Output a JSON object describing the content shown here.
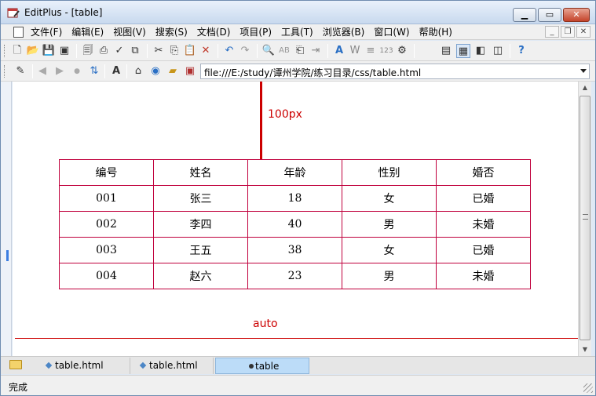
{
  "window": {
    "title": "EditPlus - [table]"
  },
  "menu": {
    "items": [
      "文件(F)",
      "编辑(E)",
      "视图(V)",
      "搜索(S)",
      "文档(D)",
      "项目(P)",
      "工具(T)",
      "浏览器(B)",
      "窗口(W)",
      "帮助(H)"
    ]
  },
  "address": {
    "url": "file:///E:/study/谭州学院/练习目录/css/table.html"
  },
  "page": {
    "label_top": "100px",
    "label_bottom": "auto",
    "table": [
      [
        "编号",
        "姓名",
        "年龄",
        "性别",
        "婚否"
      ],
      [
        "001",
        "张三",
        "18",
        "女",
        "已婚"
      ],
      [
        "002",
        "李四",
        "40",
        "男",
        "未婚"
      ],
      [
        "003",
        "王五",
        "38",
        "女",
        "已婚"
      ],
      [
        "004",
        "赵六",
        "23",
        "男",
        "未婚"
      ]
    ]
  },
  "tabs": {
    "items": [
      "table.html",
      "table.html",
      "table"
    ],
    "active": 2
  },
  "status": {
    "text": "完成"
  },
  "colors": {
    "accent_red": "#cc0000",
    "table_border": "#c0003c",
    "active_tab": "#bcdcf8"
  },
  "icons": {
    "toolbar1": [
      "new-file-icon",
      "open-icon",
      "save-icon",
      "save-all-icon",
      "print-preview-icon",
      "print-icon",
      "spell-check-icon",
      "cut-icon",
      "copy-icon",
      "paste-icon",
      "delete-icon",
      "undo-icon",
      "redo-icon",
      "find-icon",
      "replace-icon",
      "copy-html-icon",
      "insert-icon",
      "font-icon",
      "word-wrap-icon",
      "line-number-icon",
      "ruler-icon",
      "settings-icon",
      "view-icon",
      "active-view-icon",
      "toggle-icon",
      "fullscreen-icon",
      "help-icon"
    ],
    "toolbar2": [
      "edit-pencil-icon",
      "back-icon",
      "forward-icon",
      "stop-icon",
      "refresh-icon",
      "font-size-icon",
      "home-icon",
      "search-web-icon",
      "open-folder-icon",
      "browser-icon"
    ]
  }
}
